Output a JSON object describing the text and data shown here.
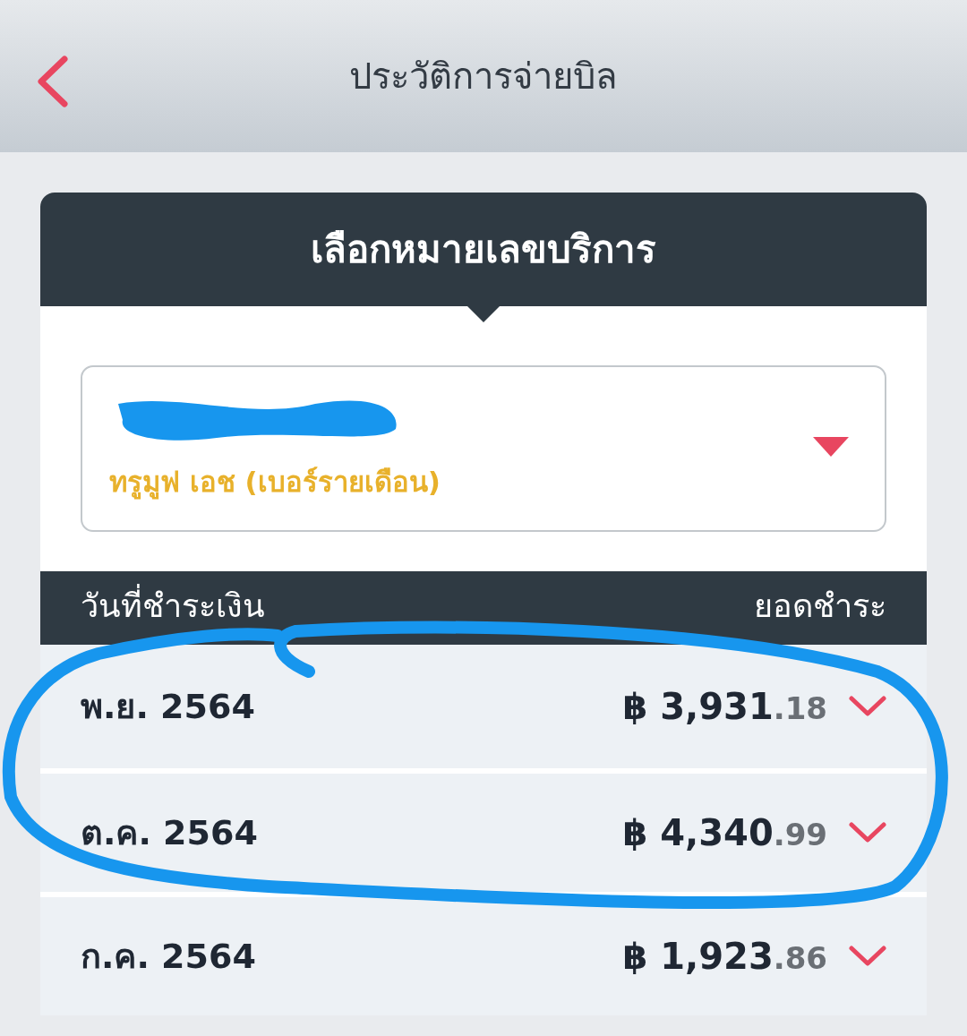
{
  "header": {
    "title": "ประวัติการจ่ายบิล"
  },
  "service_selector": {
    "title": "เลือกหมายเลขบริการ",
    "plan": "ทรูมูฟ เอช (เบอร์รายเดือน)"
  },
  "table": {
    "columns": [
      "วันที่ชำระเงิน",
      "ยอดชำระ"
    ],
    "rows": [
      {
        "date": "พ.ย. 2564",
        "currency": "฿",
        "amount": "3,931",
        "decimals": ".18"
      },
      {
        "date": "ต.ค. 2564",
        "currency": "฿",
        "amount": "4,340",
        "decimals": ".99"
      },
      {
        "date": "ก.ค. 2564",
        "currency": "฿",
        "amount": "1,923",
        "decimals": ".86"
      }
    ]
  }
}
